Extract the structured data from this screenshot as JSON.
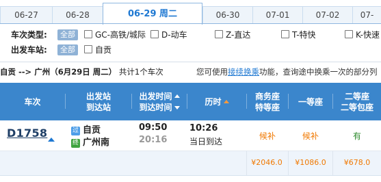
{
  "tabs": [
    "06-27",
    "06-28",
    "06-29 周二",
    "06-30",
    "07-01",
    "07-02",
    "07-"
  ],
  "filters": {
    "train_type_label": "车次类型:",
    "depart_station_label": "出发车站:",
    "all_label": "全部",
    "train_types": [
      "GC-高铁/城际",
      "D-动车",
      "Z-直达",
      "T-特快",
      "K-快速"
    ],
    "stations": [
      "自贡"
    ]
  },
  "summary": {
    "route": "自贡 --> 广州",
    "date": "（6月29日  周二）",
    "count_text": "共计1个车次",
    "tip_prefix": "您可使用",
    "tip_link": "接续换乘",
    "tip_suffix": "功能，查询途中换乘一次的部分列"
  },
  "headers": {
    "train": "车次",
    "station_1": "出发站",
    "station_2": "到达站",
    "time_1": "出发时间",
    "time_2": "到达时间",
    "duration": "历时",
    "business_1": "商务座",
    "business_2": "特等座",
    "first": "一等座",
    "second_1": "二等座",
    "second_2": "二等包座"
  },
  "train": {
    "number": "D1758",
    "from_tag": "过",
    "from": "自贡",
    "to_tag": "终",
    "to": "广州南",
    "depart": "09:50",
    "arrive": "20:16",
    "duration": "10:26",
    "arrive_day": "当日到达",
    "business": "候补",
    "first": "候补",
    "second": "有",
    "price_business": "¥2046.0",
    "price_first": "¥1086.0",
    "price_second": "¥678.0"
  },
  "colors": {
    "accent": "#1e78d2",
    "header_bg": "#3b86cc",
    "waitlist": "#f07800",
    "available": "#2e8b2e",
    "price": "#f07800"
  }
}
